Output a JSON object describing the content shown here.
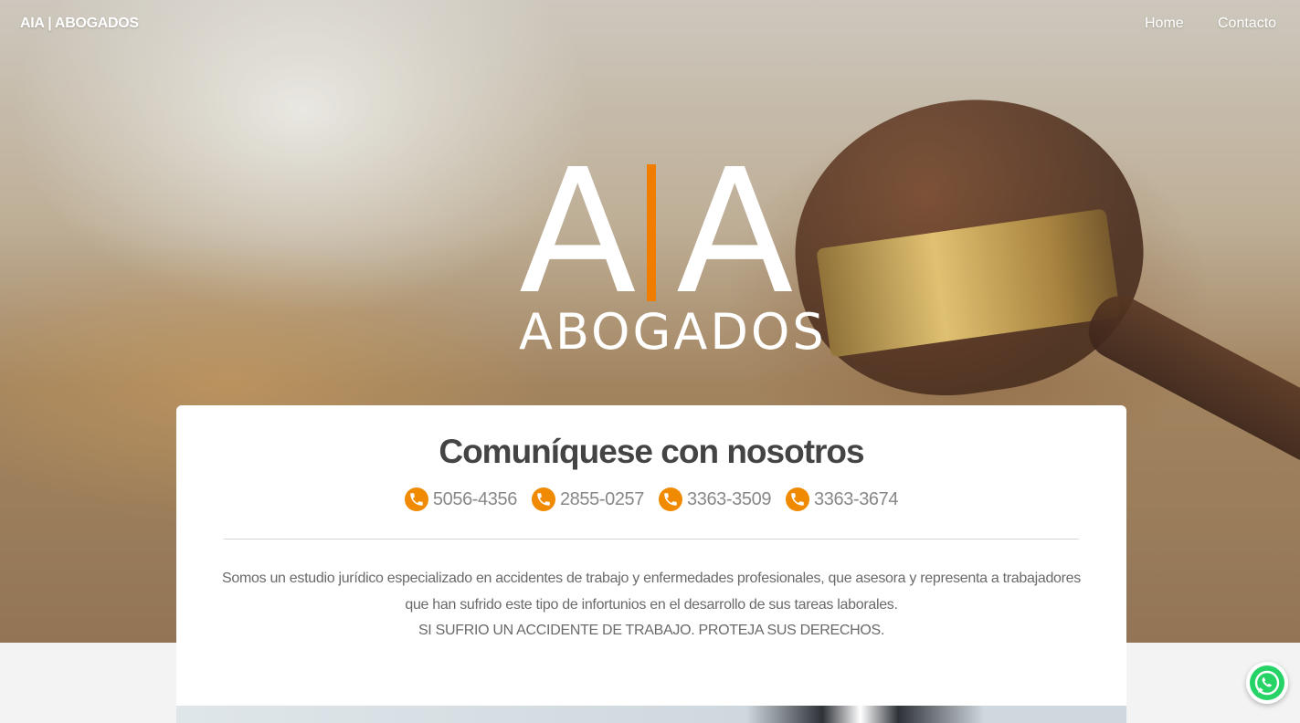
{
  "nav": {
    "brand": "AIA | ABOGADOS",
    "links": [
      {
        "label": "Home"
      },
      {
        "label": "Contacto"
      }
    ]
  },
  "hero": {
    "logo_left": "A",
    "logo_right": "A",
    "logo_subtitle": "ABOGADOS",
    "accent_color": "#f07c00"
  },
  "contact": {
    "title": "Comuníquese con nosotros",
    "phones": [
      "5056-4356",
      "2855-0257",
      "3363-3509",
      "3363-3674"
    ],
    "phone_icon": "phone-icon",
    "description_line1": "Somos un estudio jurídico especializado en accidentes de trabajo y enfermedades profesionales, que asesora y representa a trabajadores",
    "description_line2": "que han sufrido este tipo de infortunios en el desarrollo de sus tareas laborales.",
    "description_line3": "SI SUFRIO UN ACCIDENTE DE TRABAJO. PROTEJA SUS DERECHOS."
  },
  "floating": {
    "whatsapp_icon": "whatsapp-icon",
    "whatsapp_color": "#25d366"
  }
}
